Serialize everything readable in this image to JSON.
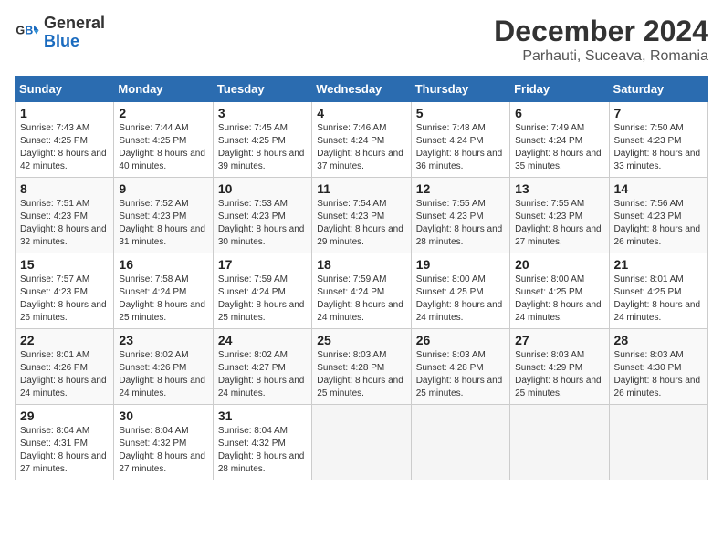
{
  "logo": {
    "line1": "General",
    "line2": "Blue"
  },
  "title": "December 2024",
  "location": "Parhauti, Suceava, Romania",
  "weekdays": [
    "Sunday",
    "Monday",
    "Tuesday",
    "Wednesday",
    "Thursday",
    "Friday",
    "Saturday"
  ],
  "weeks": [
    [
      {
        "day": "1",
        "sunrise": "7:43 AM",
        "sunset": "4:25 PM",
        "daylight": "8 hours and 42 minutes."
      },
      {
        "day": "2",
        "sunrise": "7:44 AM",
        "sunset": "4:25 PM",
        "daylight": "8 hours and 40 minutes."
      },
      {
        "day": "3",
        "sunrise": "7:45 AM",
        "sunset": "4:25 PM",
        "daylight": "8 hours and 39 minutes."
      },
      {
        "day": "4",
        "sunrise": "7:46 AM",
        "sunset": "4:24 PM",
        "daylight": "8 hours and 37 minutes."
      },
      {
        "day": "5",
        "sunrise": "7:48 AM",
        "sunset": "4:24 PM",
        "daylight": "8 hours and 36 minutes."
      },
      {
        "day": "6",
        "sunrise": "7:49 AM",
        "sunset": "4:24 PM",
        "daylight": "8 hours and 35 minutes."
      },
      {
        "day": "7",
        "sunrise": "7:50 AM",
        "sunset": "4:23 PM",
        "daylight": "8 hours and 33 minutes."
      }
    ],
    [
      {
        "day": "8",
        "sunrise": "7:51 AM",
        "sunset": "4:23 PM",
        "daylight": "8 hours and 32 minutes."
      },
      {
        "day": "9",
        "sunrise": "7:52 AM",
        "sunset": "4:23 PM",
        "daylight": "8 hours and 31 minutes."
      },
      {
        "day": "10",
        "sunrise": "7:53 AM",
        "sunset": "4:23 PM",
        "daylight": "8 hours and 30 minutes."
      },
      {
        "day": "11",
        "sunrise": "7:54 AM",
        "sunset": "4:23 PM",
        "daylight": "8 hours and 29 minutes."
      },
      {
        "day": "12",
        "sunrise": "7:55 AM",
        "sunset": "4:23 PM",
        "daylight": "8 hours and 28 minutes."
      },
      {
        "day": "13",
        "sunrise": "7:55 AM",
        "sunset": "4:23 PM",
        "daylight": "8 hours and 27 minutes."
      },
      {
        "day": "14",
        "sunrise": "7:56 AM",
        "sunset": "4:23 PM",
        "daylight": "8 hours and 26 minutes."
      }
    ],
    [
      {
        "day": "15",
        "sunrise": "7:57 AM",
        "sunset": "4:23 PM",
        "daylight": "8 hours and 26 minutes."
      },
      {
        "day": "16",
        "sunrise": "7:58 AM",
        "sunset": "4:24 PM",
        "daylight": "8 hours and 25 minutes."
      },
      {
        "day": "17",
        "sunrise": "7:59 AM",
        "sunset": "4:24 PM",
        "daylight": "8 hours and 25 minutes."
      },
      {
        "day": "18",
        "sunrise": "7:59 AM",
        "sunset": "4:24 PM",
        "daylight": "8 hours and 24 minutes."
      },
      {
        "day": "19",
        "sunrise": "8:00 AM",
        "sunset": "4:25 PM",
        "daylight": "8 hours and 24 minutes."
      },
      {
        "day": "20",
        "sunrise": "8:00 AM",
        "sunset": "4:25 PM",
        "daylight": "8 hours and 24 minutes."
      },
      {
        "day": "21",
        "sunrise": "8:01 AM",
        "sunset": "4:25 PM",
        "daylight": "8 hours and 24 minutes."
      }
    ],
    [
      {
        "day": "22",
        "sunrise": "8:01 AM",
        "sunset": "4:26 PM",
        "daylight": "8 hours and 24 minutes."
      },
      {
        "day": "23",
        "sunrise": "8:02 AM",
        "sunset": "4:26 PM",
        "daylight": "8 hours and 24 minutes."
      },
      {
        "day": "24",
        "sunrise": "8:02 AM",
        "sunset": "4:27 PM",
        "daylight": "8 hours and 24 minutes."
      },
      {
        "day": "25",
        "sunrise": "8:03 AM",
        "sunset": "4:28 PM",
        "daylight": "8 hours and 25 minutes."
      },
      {
        "day": "26",
        "sunrise": "8:03 AM",
        "sunset": "4:28 PM",
        "daylight": "8 hours and 25 minutes."
      },
      {
        "day": "27",
        "sunrise": "8:03 AM",
        "sunset": "4:29 PM",
        "daylight": "8 hours and 25 minutes."
      },
      {
        "day": "28",
        "sunrise": "8:03 AM",
        "sunset": "4:30 PM",
        "daylight": "8 hours and 26 minutes."
      }
    ],
    [
      {
        "day": "29",
        "sunrise": "8:04 AM",
        "sunset": "4:31 PM",
        "daylight": "8 hours and 27 minutes."
      },
      {
        "day": "30",
        "sunrise": "8:04 AM",
        "sunset": "4:32 PM",
        "daylight": "8 hours and 27 minutes."
      },
      {
        "day": "31",
        "sunrise": "8:04 AM",
        "sunset": "4:32 PM",
        "daylight": "8 hours and 28 minutes."
      },
      null,
      null,
      null,
      null
    ]
  ]
}
